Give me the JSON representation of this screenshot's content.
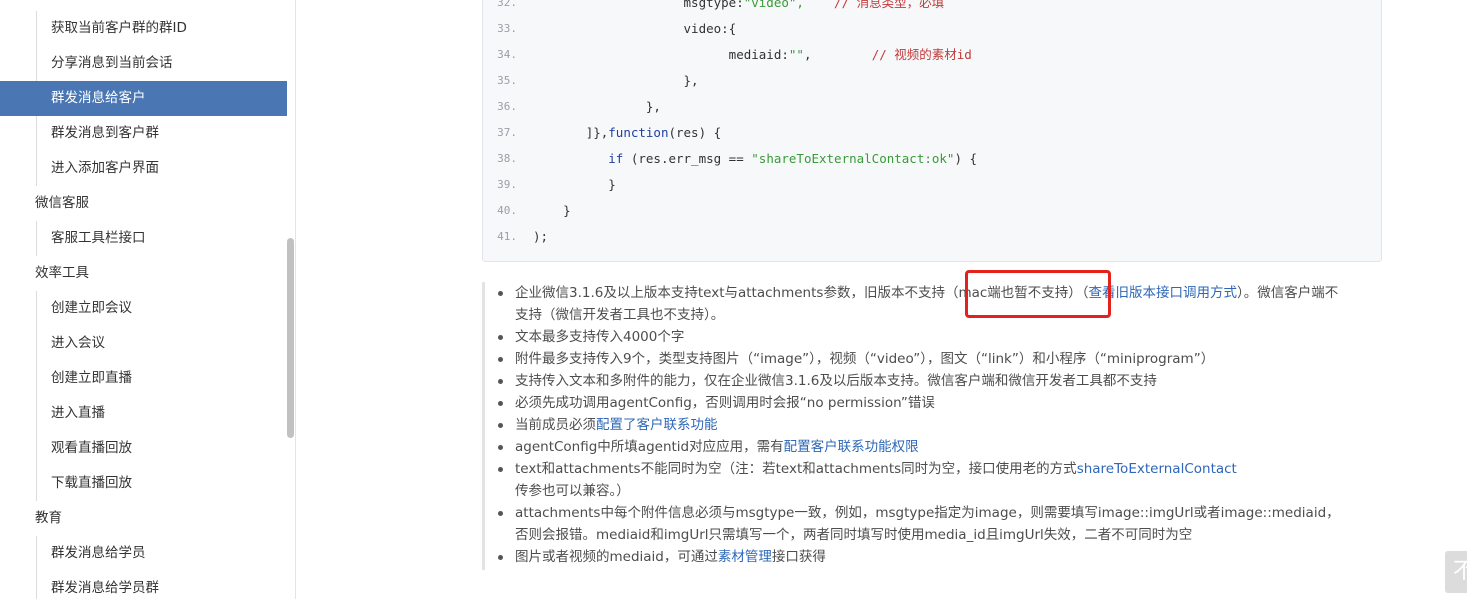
{
  "sidebar": {
    "items": [
      {
        "label": "获取当前客户群的群ID",
        "type": "sub",
        "active": false
      },
      {
        "label": "分享消息到当前会话",
        "type": "sub",
        "active": false
      },
      {
        "label": "群发消息给客户",
        "type": "sub",
        "active": true
      },
      {
        "label": "群发消息到客户群",
        "type": "sub",
        "active": false
      },
      {
        "label": "进入添加客户界面",
        "type": "sub",
        "active": false
      },
      {
        "label": "微信客服",
        "type": "group",
        "active": false
      },
      {
        "label": "客服工具栏接口",
        "type": "sub",
        "active": false
      },
      {
        "label": "效率工具",
        "type": "group",
        "active": false
      },
      {
        "label": "创建立即会议",
        "type": "sub",
        "active": false
      },
      {
        "label": "进入会议",
        "type": "sub",
        "active": false
      },
      {
        "label": "创建立即直播",
        "type": "sub",
        "active": false
      },
      {
        "label": "进入直播",
        "type": "sub",
        "active": false
      },
      {
        "label": "观看直播回放",
        "type": "sub",
        "active": false
      },
      {
        "label": "下载直播回放",
        "type": "sub",
        "active": false
      },
      {
        "label": "教育",
        "type": "group",
        "active": false
      },
      {
        "label": "群发消息给学员",
        "type": "sub",
        "active": false
      },
      {
        "label": "群发消息给学员群",
        "type": "sub",
        "active": false
      }
    ]
  },
  "code": {
    "lines": [
      {
        "num": "32.",
        "indent": "                    ",
        "parts": [
          {
            "t": "msgtype:",
            "c": "plain"
          },
          {
            "t": "\"video\",",
            "c": "str"
          },
          {
            "t": "    // 消息类型，必填",
            "c": "cmt"
          }
        ]
      },
      {
        "num": "33.",
        "indent": "                    ",
        "parts": [
          {
            "t": "video:{",
            "c": "plain"
          }
        ]
      },
      {
        "num": "34.",
        "indent": "                          ",
        "parts": [
          {
            "t": "mediaid:",
            "c": "plain"
          },
          {
            "t": "\"\"",
            "c": "str"
          },
          {
            "t": ",",
            "c": "plain"
          },
          {
            "t": "        // 视频的素材id",
            "c": "cmt"
          }
        ]
      },
      {
        "num": "35.",
        "indent": "                    ",
        "parts": [
          {
            "t": "},",
            "c": "plain"
          }
        ]
      },
      {
        "num": "36.",
        "indent": "               ",
        "parts": [
          {
            "t": "},",
            "c": "plain"
          }
        ]
      },
      {
        "num": "37.",
        "indent": "       ",
        "parts": [
          {
            "t": "]},",
            "c": "plain"
          },
          {
            "t": "function",
            "c": "kw"
          },
          {
            "t": "(res) {",
            "c": "plain"
          }
        ]
      },
      {
        "num": "38.",
        "indent": "          ",
        "parts": [
          {
            "t": "if",
            "c": "kw"
          },
          {
            "t": " (res.err_msg == ",
            "c": "plain"
          },
          {
            "t": "\"shareToExternalContact:ok\"",
            "c": "str"
          },
          {
            "t": ") {",
            "c": "plain"
          }
        ]
      },
      {
        "num": "39.",
        "indent": "          ",
        "parts": [
          {
            "t": "}",
            "c": "plain"
          }
        ]
      },
      {
        "num": "40.",
        "indent": "    ",
        "parts": [
          {
            "t": "}",
            "c": "plain"
          }
        ]
      },
      {
        "num": "41.",
        "indent": "",
        "parts": [
          {
            "t": ");",
            "c": "plain"
          }
        ]
      }
    ]
  },
  "notes": {
    "items": [
      {
        "parts": [
          {
            "t": "企业微信3.1.6及以上版本支持text与attachments参数，旧版本不支持（mac端也暂不支持）（",
            "c": "text"
          },
          {
            "t": "查看旧版本接口调用方式",
            "c": "link"
          },
          {
            "t": "）。微信客户端不支持（微信开发者工具也不支持）。",
            "c": "text"
          }
        ]
      },
      {
        "parts": [
          {
            "t": "文本最多支持传入4000个字",
            "c": "text"
          }
        ]
      },
      {
        "parts": [
          {
            "t": "附件最多支持传入9个，类型支持图片（“image”），视频（“video”），图文（“link”）和小程序（“miniprogram”）",
            "c": "text"
          }
        ]
      },
      {
        "parts": [
          {
            "t": "支持传入文本和多附件的能力，仅在企业微信3.1.6及以后版本支持。微信客户端和微信开发者工具都不支持",
            "c": "text"
          }
        ]
      },
      {
        "parts": [
          {
            "t": "必须先成功调用agentConfig，否则调用时会报“no permission”错误",
            "c": "text"
          }
        ]
      },
      {
        "parts": [
          {
            "t": "当前成员必须",
            "c": "text"
          },
          {
            "t": "配置了客户联系功能",
            "c": "link"
          }
        ]
      },
      {
        "parts": [
          {
            "t": "agentConfig中所填agentid对应应用，需有",
            "c": "text"
          },
          {
            "t": "配置客户联系功能权限",
            "c": "link"
          }
        ]
      },
      {
        "parts": [
          {
            "t": "text和attachments不能同时为空（注：若text和attachments同时为空，接口使用老的方式",
            "c": "text"
          },
          {
            "t": "shareToExternalContact",
            "c": "link"
          },
          {
            "t": "传参也可以兼容。）",
            "c": "text"
          }
        ]
      },
      {
        "parts": [
          {
            "t": "attachments中每个附件信息必须与msgtype一致，例如，msgtype指定为image，则需要填写image::imgUrl或者image::mediaid，否则会报错。mediaid和imgUrl只需填写一个，两者同时填写时使用media_id且imgUrl失效，二者不可同时为空",
            "c": "text"
          }
        ]
      },
      {
        "parts": [
          {
            "t": "图片或者视频的mediaid，可通过",
            "c": "text"
          },
          {
            "t": "素材管理",
            "c": "link"
          },
          {
            "t": "接口获得",
            "c": "text"
          }
        ]
      }
    ]
  },
  "floating": {
    "label": "不"
  },
  "colors": {
    "accent": "#4a76b3",
    "link": "#2e67b8",
    "highlight": "#e3231b"
  }
}
